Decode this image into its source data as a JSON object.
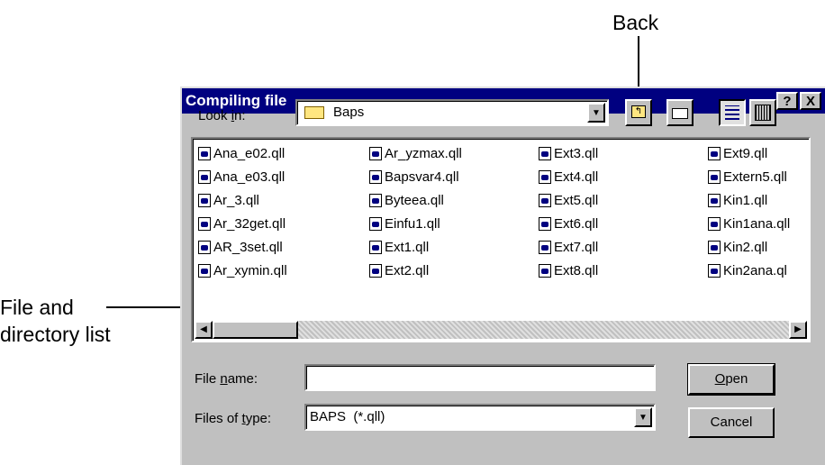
{
  "callouts": {
    "back": "Back",
    "file_list_line1": "File and",
    "file_list_line2": "directory list"
  },
  "dialog": {
    "title": "Compiling file",
    "help_button": "?",
    "close_button": "X",
    "look_in_label": "Look in:",
    "look_in_value": "Baps",
    "file_name_label": "File name:",
    "file_name_value": "",
    "files_of_type_label": "Files of type:",
    "files_of_type_value": "BAPS  (*.qll)",
    "open_button": "Open",
    "cancel_button": "Cancel",
    "toolbar_icons": [
      "up-one-level-icon",
      "create-new-folder-icon",
      "list-view-icon",
      "details-view-icon"
    ],
    "files": {
      "col1": [
        "Ana_e02.qll",
        "Ana_e03.qll",
        "Ar_3.qll",
        "Ar_32get.qll",
        "AR_3set.qll",
        "Ar_xymin.qll"
      ],
      "col2": [
        "Ar_yzmax.qll",
        "Bapsvar4.qll",
        "Byteea.qll",
        "Einfu1.qll",
        "Ext1.qll",
        "Ext2.qll"
      ],
      "col3": [
        "Ext3.qll",
        "Ext4.qll",
        "Ext5.qll",
        "Ext6.qll",
        "Ext7.qll",
        "Ext8.qll"
      ],
      "col4": [
        "Ext9.qll",
        "Extern5.qll",
        "Kin1.qll",
        "Kin1ana.qll",
        "Kin2.qll",
        "Kin2ana.ql"
      ]
    }
  }
}
